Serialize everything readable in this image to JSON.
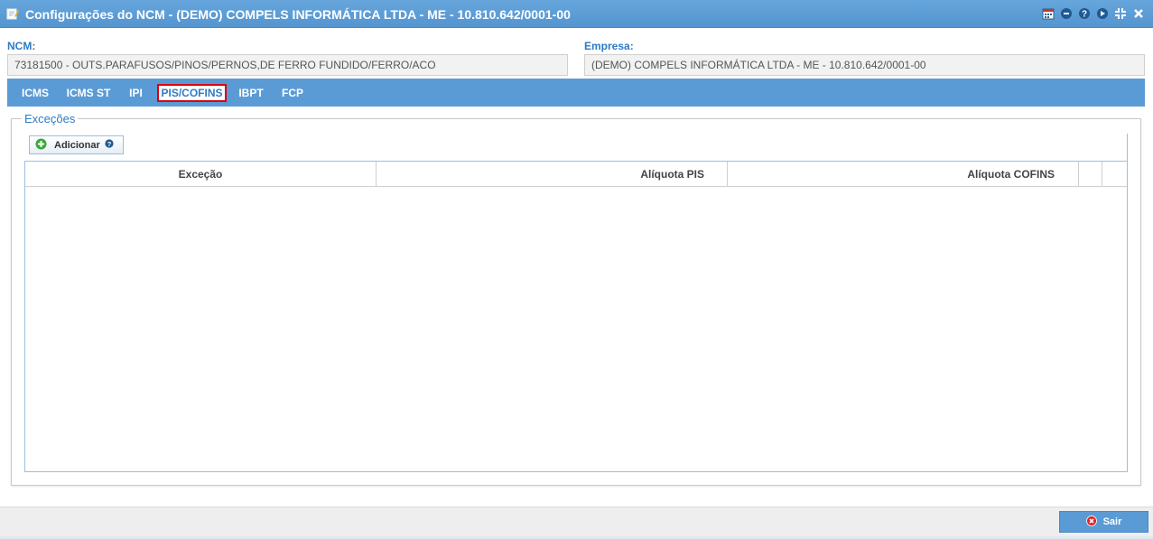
{
  "window": {
    "title": "Configurações do NCM - (DEMO) COMPELS INFORMÁTICA LTDA - ME - 10.810.642/0001-00",
    "title_icon": "edit-document-icon",
    "actions": [
      "calendar-icon",
      "minimize-icon",
      "help-icon",
      "play-icon",
      "resize-icon",
      "close-icon"
    ]
  },
  "form": {
    "ncm_label": "NCM:",
    "ncm_value": "73181500 - OUTS.PARAFUSOS/PINOS/PERNOS,DE FERRO FUNDIDO/FERRO/ACO",
    "empresa_label": "Empresa:",
    "empresa_value": "(DEMO) COMPELS INFORMÁTICA LTDA - ME - 10.810.642/0001-00"
  },
  "tabs": [
    {
      "label": "ICMS",
      "active": false
    },
    {
      "label": "ICMS ST",
      "active": false
    },
    {
      "label": "IPI",
      "active": false
    },
    {
      "label": "PIS/COFINS",
      "active": true
    },
    {
      "label": "IBPT",
      "active": false
    },
    {
      "label": "FCP",
      "active": false
    }
  ],
  "excecoes": {
    "legend": "Exceções",
    "add_label": "Adicionar",
    "columns": [
      "Exceção",
      "Alíquota PIS",
      "Alíquota COFINS"
    ],
    "rows": []
  },
  "footer": {
    "exit_label": "Sair"
  },
  "colors": {
    "accent": "#5b9bd5",
    "label_blue": "#2e7bc4",
    "active_tab_border": "#d9000d"
  }
}
